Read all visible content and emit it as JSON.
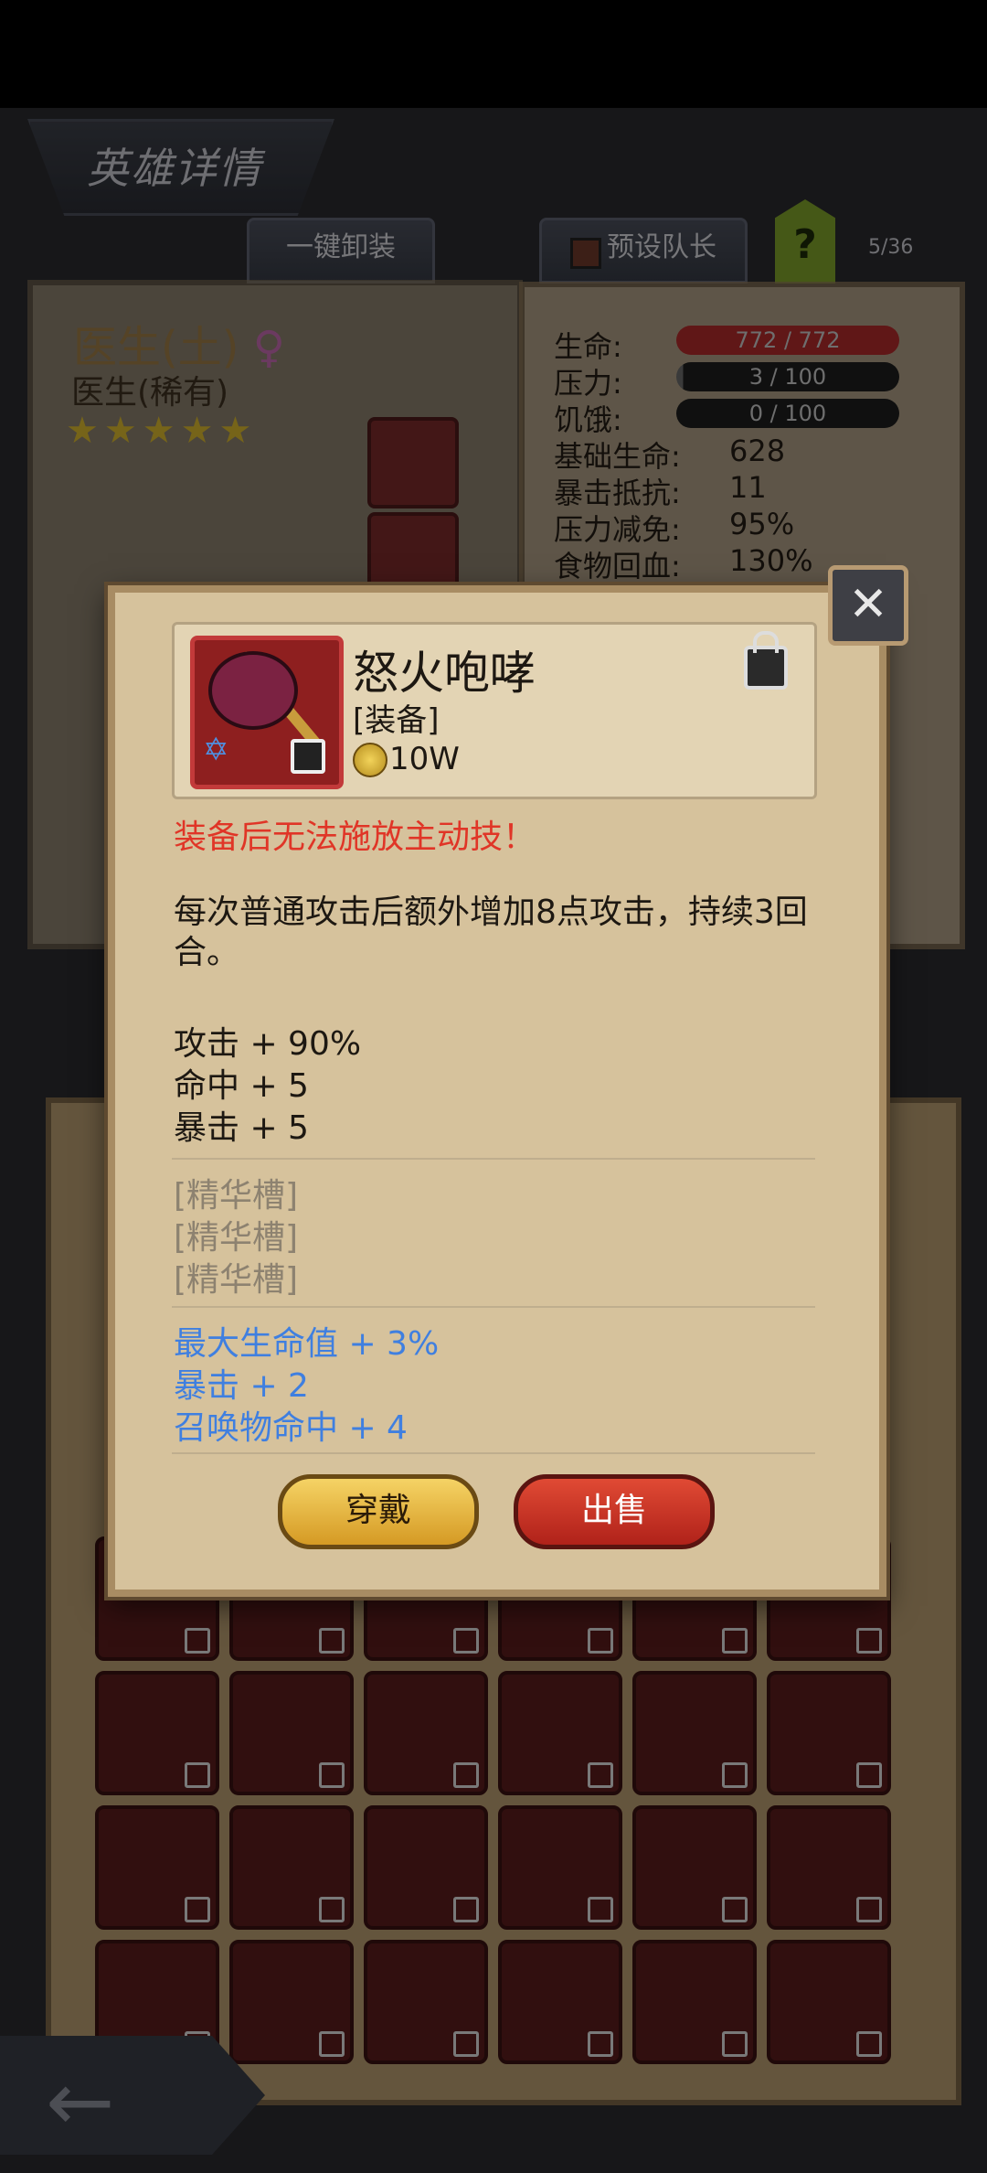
{
  "header": {
    "title": "英雄详情",
    "unequip_all": "一键卸装",
    "preset_leader": "预设队长",
    "help": "?",
    "slot_count": "5/36"
  },
  "hero": {
    "name": "医生(土)",
    "gender": "♀",
    "rarity": "医生(稀有)",
    "stars": "★★★★★"
  },
  "stats": {
    "life_label": "生命:",
    "life_value": "772 / 772",
    "life_fill": 1.0,
    "pressure_label": "压力:",
    "pressure_value": "3 / 100",
    "pressure_fill": 0.03,
    "hunger_label": "饥饿:",
    "hunger_value": "0 / 100",
    "hunger_fill": 0.0,
    "base_life_label": "基础生命:",
    "base_life_value": "628",
    "crit_resist_label": "暴击抵抗:",
    "crit_resist_value": "11",
    "pressure_reduce_label": "压力减免:",
    "pressure_reduce_value": "95%",
    "food_heal_label": "食物回血:",
    "food_heal_value": "130%"
  },
  "item": {
    "name": "怒火咆哮",
    "type": "[装备]",
    "price": "10W",
    "warning": "装备后无法施放主动技！",
    "description": "每次普通攻击后额外增加8点攻击，持续3回合。",
    "base_stats": [
      "攻击 + 90%",
      "命中 + 5",
      "暴击 + 5"
    ],
    "essence_slots": [
      "[精华槽]",
      "[精华槽]",
      "[精华槽]"
    ],
    "bonus_stats": [
      "最大生命值 + 3%",
      "暴击 + 2",
      "召唤物命中 + 4"
    ]
  },
  "actions": {
    "equip": "穿戴",
    "sell": "出售"
  },
  "icons": {
    "close": "close-icon",
    "lock": "lock-icon",
    "coin": "coin-icon",
    "back": "back-arrow-icon"
  }
}
